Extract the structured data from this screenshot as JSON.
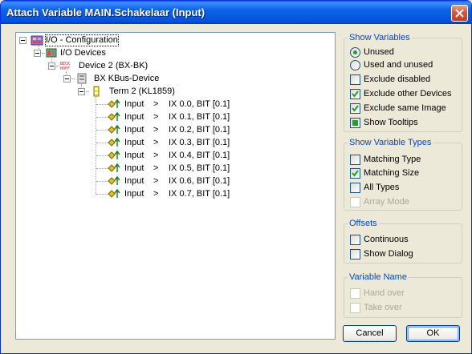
{
  "window": {
    "title": "Attach Variable MAIN.Schakelaar (Input)"
  },
  "tree": {
    "root": "I/O - Configuration",
    "io_devices": "I/O Devices",
    "device": "Device 2 (BX-BK)",
    "bx_kbus": "BX KBus-Device",
    "term": "Term 2 (KL1859)",
    "inputs": [
      {
        "name": "Input",
        "arrow": ">",
        "addr": "IX 0.0, BIT [0.1]"
      },
      {
        "name": "Input",
        "arrow": ">",
        "addr": "IX 0.1, BIT [0.1]"
      },
      {
        "name": "Input",
        "arrow": ">",
        "addr": "IX 0.2, BIT [0.1]"
      },
      {
        "name": "Input",
        "arrow": ">",
        "addr": "IX 0.3, BIT [0.1]"
      },
      {
        "name": "Input",
        "arrow": ">",
        "addr": "IX 0.4, BIT [0.1]"
      },
      {
        "name": "Input",
        "arrow": ">",
        "addr": "IX 0.5, BIT [0.1]"
      },
      {
        "name": "Input",
        "arrow": ">",
        "addr": "IX 0.6, BIT [0.1]"
      },
      {
        "name": "Input",
        "arrow": ">",
        "addr": "IX 0.7, BIT [0.1]"
      }
    ]
  },
  "show_variables": {
    "title": "Show Variables",
    "unused": {
      "label": "Unused",
      "selected": true
    },
    "used_and_unused": {
      "label": "Used and unused",
      "selected": false
    },
    "exclude_disabled": {
      "label": "Exclude disabled",
      "checked": false
    },
    "exclude_other_devices": {
      "label": "Exclude other Devices",
      "checked": true
    },
    "exclude_same_image": {
      "label": "Exclude same Image",
      "checked": true
    },
    "show_tooltips": {
      "label": "Show Tooltips",
      "state": "indeterminate"
    }
  },
  "show_variable_types": {
    "title": "Show Variable Types",
    "matching_type": {
      "label": "Matching Type",
      "checked": false
    },
    "matching_size": {
      "label": "Matching Size",
      "checked": true
    },
    "all_types": {
      "label": "All Types",
      "checked": false
    },
    "array_mode": {
      "label": "Array Mode",
      "checked": false,
      "disabled": true
    }
  },
  "offsets": {
    "title": "Offsets",
    "continuous": {
      "label": "Continuous",
      "checked": false
    },
    "show_dialog": {
      "label": "Show Dialog",
      "checked": false
    }
  },
  "variable_name": {
    "title": "Variable Name",
    "hand_over": {
      "label": "Hand over",
      "checked": false,
      "disabled": true
    },
    "take_over": {
      "label": "Take over",
      "checked": false,
      "disabled": true
    }
  },
  "buttons": {
    "cancel": "Cancel",
    "ok": "OK"
  },
  "colors": {
    "title_bar": "#0553D8",
    "group_title": "#0046D5",
    "check_green": "#21A121"
  }
}
